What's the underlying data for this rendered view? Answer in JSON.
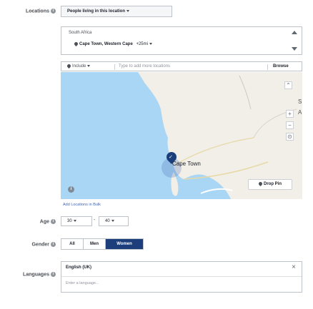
{
  "locations": {
    "label": "Locations",
    "type_selector": "People living in this location",
    "country": "South Africa",
    "city": "Cape Town, Western Cape",
    "radius": "+25mi",
    "include_label": "Include",
    "search_placeholder": "Type to add more locations",
    "browse": "Browse"
  },
  "map": {
    "city_label": "Cape Town",
    "drop_pin": "Drop Pin",
    "edge_letters": [
      "S",
      "A"
    ],
    "zoom_in": "+",
    "zoom_out": "−"
  },
  "bulk_link": "Add Locations in Bulk",
  "age": {
    "label": "Age",
    "min": "30",
    "separator": "-",
    "max": "40"
  },
  "gender": {
    "label": "Gender",
    "options": [
      "All",
      "Men",
      "Women"
    ],
    "selected": "Women"
  },
  "languages": {
    "label": "Languages",
    "selected": "English (UK)",
    "remove": "×",
    "placeholder": "Enter a language..."
  },
  "colors": {
    "accent": "#1c3f7c",
    "water": "#a9d6f5",
    "land": "#f2efe9",
    "link": "#4267b2"
  }
}
